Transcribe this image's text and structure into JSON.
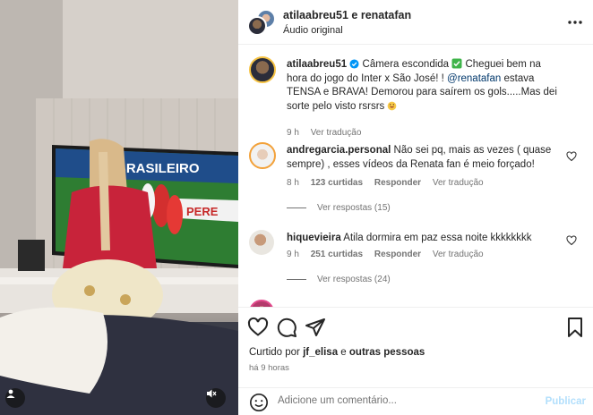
{
  "header": {
    "title": "atilaabreu51 e renatafan",
    "subtitle": "Áudio original"
  },
  "caption": {
    "username": "atilaabreu51",
    "text_part1": "Câmera escondida",
    "text_part2": "Cheguei bem na hora do jogo do Inter x São José! !",
    "mention": "@renatafan",
    "text_part3": "estava TENSA e BRAVA! Demorou para saírem os gols.....Mas dei sorte pelo visto rsrsrs",
    "time": "9 h",
    "translate": "Ver tradução"
  },
  "comments": [
    {
      "username": "andregarcia.personal",
      "text": "Não sei pq, mais as vezes ( quase sempre) , esses vídeos da Renata fan é meio forçado!",
      "time": "8 h",
      "likes": "123 curtidas",
      "reply": "Responder",
      "translate": "Ver tradução",
      "view_replies": "Ver respostas (15)"
    },
    {
      "username": "hiquevieira",
      "text": "Atila dormira em paz essa noite kkkkkkkk",
      "time": "9 h",
      "likes": "251 curtidas",
      "reply": "Responder",
      "translate": "Ver tradução",
      "view_replies": "Ver respostas (24)"
    }
  ],
  "video": {
    "tv_text": "BRASILEIRO",
    "tv_text2": "PERE"
  },
  "actions": {
    "liked_prefix": "Curtido por",
    "liked_user": "jf_elisa",
    "liked_suffix": "e",
    "liked_others": "outras pessoas",
    "time_ago": "há 9 horas"
  },
  "add_comment": {
    "placeholder": "Adicione um comentário...",
    "publish": "Publicar"
  },
  "colors": {
    "link": "#00376b",
    "muted": "#737373",
    "verified": "#0095f6",
    "publish_disabled": "#b2dffc"
  }
}
